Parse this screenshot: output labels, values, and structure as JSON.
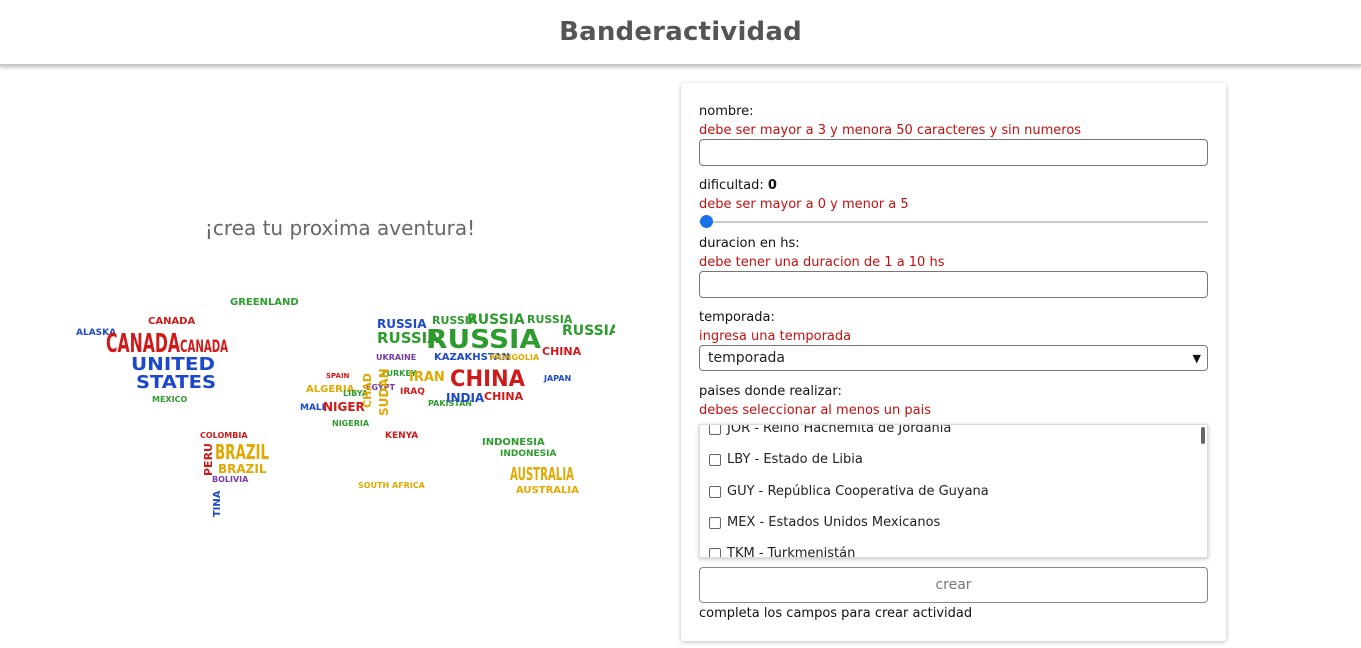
{
  "header": {
    "title": "Banderactividad"
  },
  "left": {
    "tagline": "¡crea tu proxima aventura!",
    "map_words": {
      "canada": "CANADA",
      "united": "UNITED",
      "states": "STATES",
      "alaska": "ALASKA",
      "greenland": "GREENLAND",
      "mexico": "MEXICO",
      "brazil": "BRAZIL",
      "peru": "PERU",
      "argentina": "ARGENTINA",
      "russia": "RUSSIA",
      "china": "CHINA",
      "india": "INDIA",
      "mongolia": "MONGOLIA",
      "kazakhstan": "KAZAKHSTAN",
      "iran": "IRAN",
      "iraq": "IRAQ",
      "chad": "CHAD",
      "niger": "NIGER",
      "mali": "MALI",
      "sudan": "SUDAN",
      "algeria": "ALGERIA",
      "libya": "LIBYA",
      "egypt": "EGYPT",
      "nigeria": "NIGERIA",
      "kenya": "KENYA",
      "ukraine": "UKRAINE",
      "turkey": "TURKEY",
      "pakistan": "PAKISTAN",
      "japan": "JAPAN",
      "indonesia": "INDONESIA",
      "australia": "AUSTRALIA",
      "spain": "SPAIN",
      "south_africa": "SOUTH AFRICA",
      "bolivia": "BOLIVIA",
      "colombia": "COLOMBIA"
    }
  },
  "form": {
    "nombre": {
      "label": "nombre:",
      "error": "debe ser mayor a 3 y menora 50 caracteres y sin numeros",
      "value": ""
    },
    "dificultad": {
      "label": "dificultad:",
      "value": "0",
      "error": "debe ser mayor a 0 y menor a 5",
      "slider_fraction": 0
    },
    "duracion": {
      "label": "duracion en hs:",
      "error": "debe tener una duracion de 1 a 10 hs",
      "value": ""
    },
    "temporada": {
      "label": "temporada:",
      "error": "ingresa una temporada",
      "selected": "temporada"
    },
    "paises": {
      "label": "paises donde realizar:",
      "error": "debes seleccionar al menos un pais",
      "options": [
        {
          "label": "JOR - Reino Hachemita de Jordania"
        },
        {
          "label": "LBY - Estado de Libia"
        },
        {
          "label": "GUY - República Cooperativa de Guyana"
        },
        {
          "label": "MEX - Estados Unidos Mexicanos"
        },
        {
          "label": "TKM - Turkmenistán"
        }
      ]
    },
    "submit_label": "crear",
    "hint": "completa los campos para crear actividad"
  },
  "colors": {
    "error": "#c0100f",
    "slider": "#1a73e8",
    "map_red": "#d01a1a",
    "map_blue": "#1c48c9",
    "map_green": "#2e9b2e",
    "map_yellow": "#e0a800",
    "map_purple": "#7a3aa0"
  }
}
